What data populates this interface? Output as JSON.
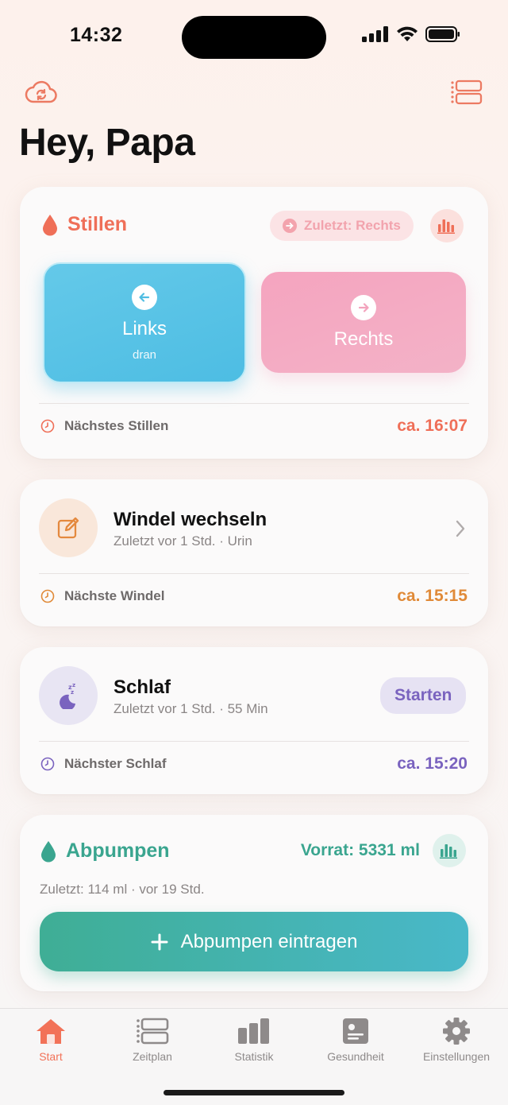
{
  "status": {
    "time": "14:32"
  },
  "header": {
    "greeting": "Hey, Papa"
  },
  "nursing": {
    "title": "Stillen",
    "last_pill": "Zuletzt: Rechts",
    "left_label": "Links",
    "left_sub": "dran",
    "right_label": "Rechts",
    "next_label": "Nächstes Stillen",
    "next_value": "ca. 16:07",
    "accent": "#f0715a"
  },
  "diaper": {
    "title": "Windel wechseln",
    "subtitle": "Zuletzt vor 1 Std. · Urin",
    "next_label": "Nächste Windel",
    "next_value": "ca. 15:15",
    "accent": "#e08a38"
  },
  "sleep": {
    "title": "Schlaf",
    "subtitle": "Zuletzt vor 1 Std. · 55 Min",
    "start_label": "Starten",
    "next_label": "Nächster Schlaf",
    "next_value": "ca. 15:20",
    "accent": "#7a63bf"
  },
  "pump": {
    "title": "Abpumpen",
    "stock": "Vorrat: 5331 ml",
    "last": "Zuletzt: 114 ml · vor 19 Std.",
    "add_label": "Abpumpen eintragen",
    "accent": "#3aa58f"
  },
  "tabs": [
    {
      "label": "Start",
      "icon": "home-icon",
      "active": true
    },
    {
      "label": "Zeitplan",
      "icon": "schedule-icon",
      "active": false
    },
    {
      "label": "Statistik",
      "icon": "bar-chart-icon",
      "active": false
    },
    {
      "label": "Gesundheit",
      "icon": "health-icon",
      "active": false
    },
    {
      "label": "Einstellungen",
      "icon": "gear-icon",
      "active": false
    }
  ]
}
